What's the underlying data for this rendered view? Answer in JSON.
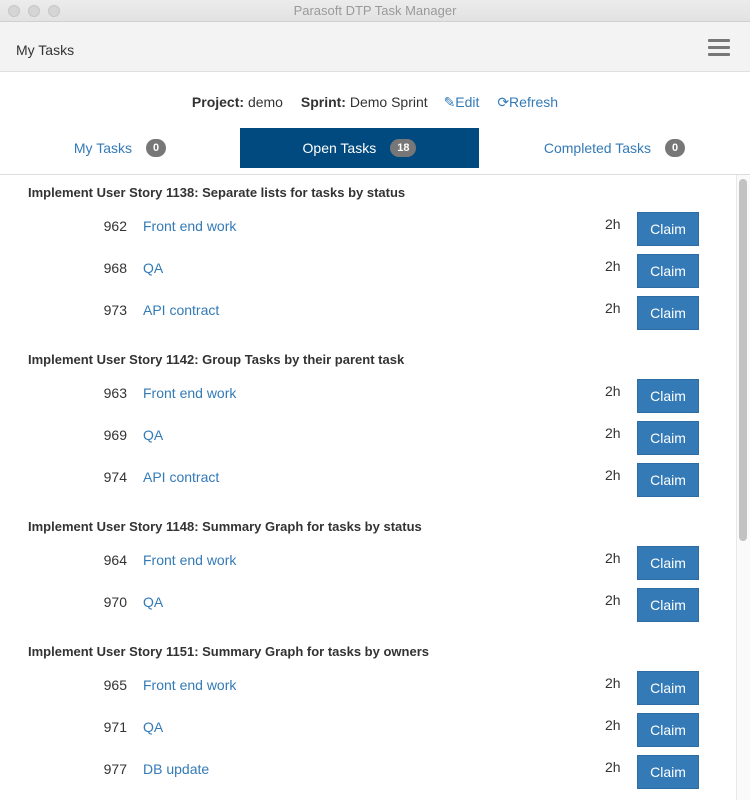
{
  "window": {
    "title": "Parasoft DTP Task Manager"
  },
  "navbar": {
    "brand": "My Tasks",
    "menu_icon": "hamburger-icon"
  },
  "info": {
    "project_label": "Project:",
    "project": "demo",
    "sprint_label": "Sprint:",
    "sprint": "Demo Sprint",
    "edit": "Edit",
    "refresh": "Refresh"
  },
  "tabs": [
    {
      "label": "My Tasks",
      "count": "0"
    },
    {
      "label": "Open Tasks",
      "count": "18",
      "active": true
    },
    {
      "label": "Completed Tasks",
      "count": "0"
    }
  ],
  "colors": {
    "primary": "#337ab7",
    "active_tab": "#004a7f",
    "badge": "#777777"
  },
  "groups": [
    {
      "title": "Implement User Story 1138: Separate lists for tasks by status",
      "tasks": [
        {
          "id": "962",
          "name": "Front end work",
          "est": "2h"
        },
        {
          "id": "968",
          "name": "QA",
          "est": "2h"
        },
        {
          "id": "973",
          "name": "API contract",
          "est": "2h"
        }
      ]
    },
    {
      "title": "Implement User Story 1142: Group Tasks by their parent task",
      "tasks": [
        {
          "id": "963",
          "name": "Front end work",
          "est": "2h"
        },
        {
          "id": "969",
          "name": "QA",
          "est": "2h"
        },
        {
          "id": "974",
          "name": "API contract",
          "est": "2h"
        }
      ]
    },
    {
      "title": "Implement User Story 1148: Summary Graph for tasks by status",
      "tasks": [
        {
          "id": "964",
          "name": "Front end work",
          "est": "2h"
        },
        {
          "id": "970",
          "name": "QA",
          "est": "2h"
        }
      ]
    },
    {
      "title": "Implement User Story 1151: Summary Graph for tasks by owners",
      "tasks": [
        {
          "id": "965",
          "name": "Front end work",
          "est": "2h"
        },
        {
          "id": "971",
          "name": "QA",
          "est": "2h"
        },
        {
          "id": "977",
          "name": "DB update",
          "est": "2h"
        }
      ]
    }
  ],
  "claim_label": "Claim"
}
